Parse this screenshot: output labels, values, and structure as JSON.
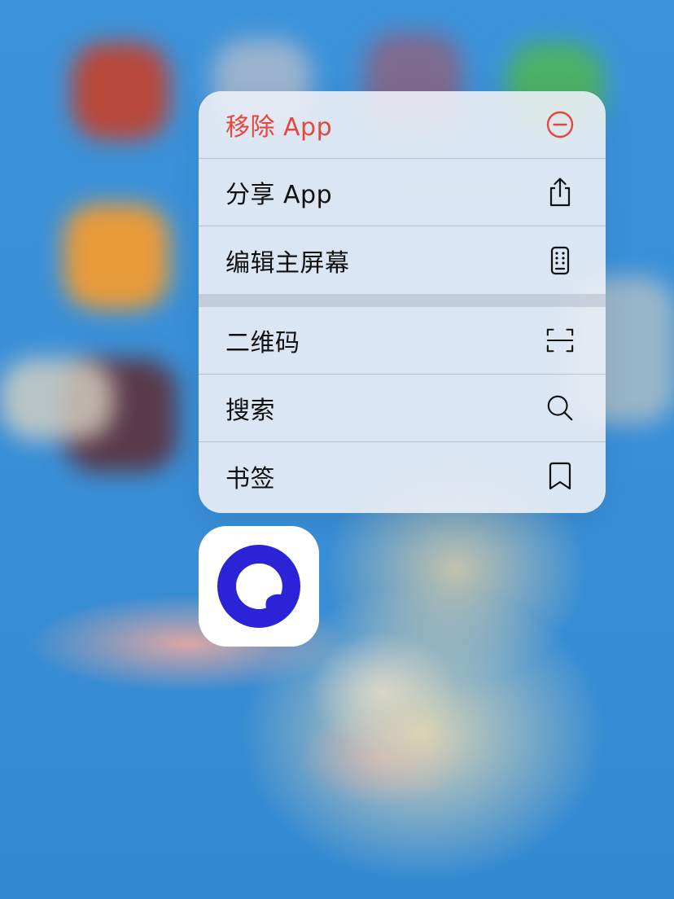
{
  "menu": {
    "items": [
      {
        "label": "移除 App",
        "icon": "minus-circle-icon",
        "destructive": true
      },
      {
        "label": "分享 App",
        "icon": "share-icon"
      },
      {
        "label": "编辑主屏幕",
        "icon": "phone-grid-icon"
      },
      {
        "label": "二维码",
        "icon": "qr-scan-icon"
      },
      {
        "label": "搜索",
        "icon": "search-icon"
      },
      {
        "label": "书签",
        "icon": "bookmark-icon"
      }
    ]
  },
  "colors": {
    "destructive": "#e8453c",
    "app_logo": "#2a24d6",
    "wallpaper": "#3a8fd6"
  },
  "app": {
    "icon": "quark-browser-app-icon"
  }
}
